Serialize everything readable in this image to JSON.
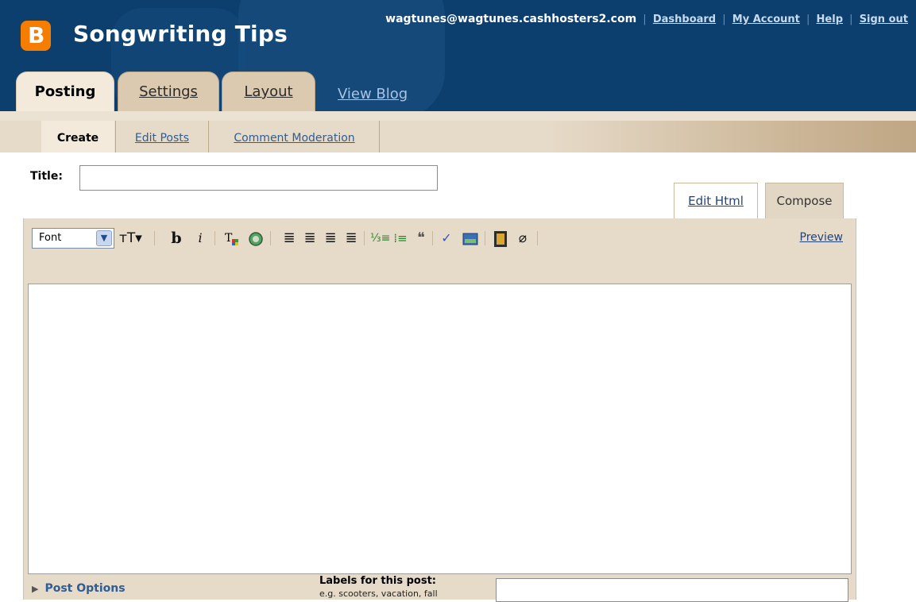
{
  "blog": {
    "title": "Songwriting Tips",
    "logo_letter": "B"
  },
  "topnav": {
    "email": "wagtunes@wagtunes.cashhosters2.com",
    "links": [
      "Dashboard",
      "My Account",
      "Help",
      "Sign out"
    ],
    "separator": "|"
  },
  "tabs": {
    "posting": "Posting",
    "settings": "Settings",
    "layout": "Layout",
    "view_blog": "View Blog"
  },
  "subnav": {
    "create": "Create",
    "edit_posts": "Edit Posts",
    "comment_moderation": "Comment Moderation"
  },
  "post": {
    "title_label": "Title:",
    "title_value": "",
    "labels_label": "Labels for this post:",
    "labels_hint": "e.g. scooters, vacation, fall",
    "post_options": "Post Options"
  },
  "editor": {
    "mode_html": "Edit Html",
    "mode_compose": "Compose",
    "font_select": "Font",
    "preview": "Preview",
    "icons": [
      "font-size-icon",
      "bold-icon",
      "italic-icon",
      "text-color-icon",
      "link-icon",
      "align-left-icon",
      "align-center-icon",
      "align-right-icon",
      "justify-icon",
      "numbered-list-icon",
      "bullet-list-icon",
      "blockquote-icon",
      "spellcheck-icon",
      "image-icon",
      "video-icon",
      "clear-format-icon"
    ]
  },
  "colors": {
    "header": "#0c3f6e",
    "accent_orange": "#f57d00",
    "panel": "#e6dac9",
    "link": "#2f5d95"
  }
}
